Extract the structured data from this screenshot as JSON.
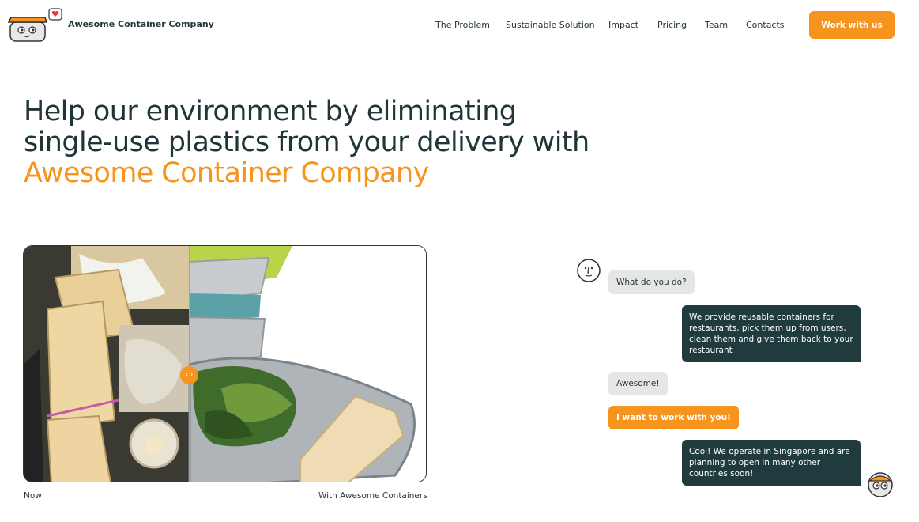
{
  "header": {
    "brand": "Awesome Container Company",
    "nav": [
      "The Problem",
      "Sustainable Solution",
      "Impact",
      "Pricing",
      "Team",
      "Contacts"
    ],
    "cta": "Work with us"
  },
  "hero": {
    "line1": "Help our environment by eliminating",
    "line2": "single-use plastics from your delivery with",
    "accent": "Awesome Container Company"
  },
  "compare": {
    "left_caption": "Now",
    "right_caption": "With Awesome Containers",
    "handle_glyph": "‹ ›"
  },
  "chat": {
    "messages": [
      {
        "from": "user",
        "text": "What do you do?"
      },
      {
        "from": "company",
        "text": "We provide reusable containers for restaurants, pick them up from users, clean them and give them back to your restaurant"
      },
      {
        "from": "user",
        "text": "Awesome!"
      },
      {
        "from": "user-action",
        "text": "I want to work with you!"
      },
      {
        "from": "company",
        "text": "Cool! We operate in Singapore and are planning to open in many other countries soon!"
      }
    ]
  },
  "colors": {
    "accent": "#f7941d",
    "dark": "#1f3538",
    "bubble_dark": "#1f3b3e",
    "bubble_grey": "#e6e6e6"
  }
}
